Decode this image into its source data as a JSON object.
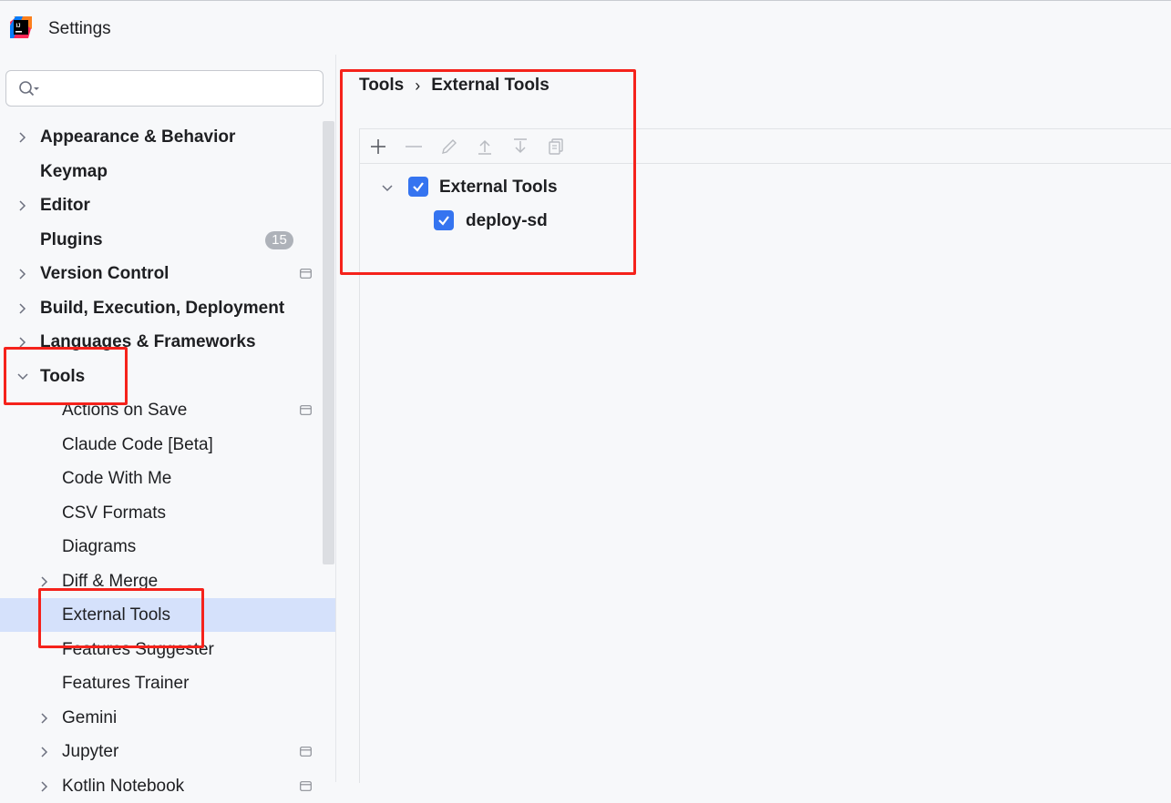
{
  "window": {
    "title": "Settings"
  },
  "search": {
    "placeholder": "",
    "value": ""
  },
  "tree": {
    "items": [
      {
        "label": "Appearance & Behavior",
        "bold": true,
        "expandable": true,
        "expanded": false
      },
      {
        "label": "Keymap",
        "bold": true,
        "expandable": false
      },
      {
        "label": "Editor",
        "bold": true,
        "expandable": true,
        "expanded": false
      },
      {
        "label": "Plugins",
        "bold": true,
        "expandable": false,
        "badge": "15"
      },
      {
        "label": "Version Control",
        "bold": true,
        "expandable": true,
        "expanded": false,
        "project_icon": true
      },
      {
        "label": "Build, Execution, Deployment",
        "bold": true,
        "expandable": true,
        "expanded": false
      },
      {
        "label": "Languages & Frameworks",
        "bold": true,
        "expandable": true,
        "expanded": false
      },
      {
        "label": "Tools",
        "bold": true,
        "expandable": true,
        "expanded": true
      },
      {
        "label": "Actions on Save",
        "bold": false,
        "expandable": false,
        "project_icon": true
      },
      {
        "label": "Claude Code [Beta]",
        "bold": false,
        "expandable": false
      },
      {
        "label": "Code With Me",
        "bold": false,
        "expandable": false
      },
      {
        "label": "CSV Formats",
        "bold": false,
        "expandable": false
      },
      {
        "label": "Diagrams",
        "bold": false,
        "expandable": false
      },
      {
        "label": "Diff & Merge",
        "bold": false,
        "expandable": true,
        "expanded": false
      },
      {
        "label": "External Tools",
        "bold": false,
        "expandable": false,
        "selected": true
      },
      {
        "label": "Features Suggester",
        "bold": false,
        "expandable": false
      },
      {
        "label": "Features Trainer",
        "bold": false,
        "expandable": false
      },
      {
        "label": "Gemini",
        "bold": false,
        "expandable": true,
        "expanded": false
      },
      {
        "label": "Jupyter",
        "bold": false,
        "expandable": true,
        "expanded": false,
        "project_icon": true
      },
      {
        "label": "Kotlin Notebook",
        "bold": false,
        "expandable": true,
        "expanded": false,
        "project_icon": true
      }
    ]
  },
  "breadcrumb": {
    "parent": "Tools",
    "separator": "›",
    "current": "External Tools"
  },
  "toolbar": {
    "buttons": [
      "add-icon",
      "remove-icon",
      "edit-icon",
      "move-up-icon",
      "move-down-icon",
      "copy-icon"
    ]
  },
  "external_tools": {
    "group_label": "External Tools",
    "group_checked": true,
    "items": [
      {
        "label": "deploy-sd",
        "checked": true
      }
    ]
  },
  "colors": {
    "accent": "#3574f0",
    "selection": "#d5e1fb",
    "annotation": "#f5221b"
  }
}
